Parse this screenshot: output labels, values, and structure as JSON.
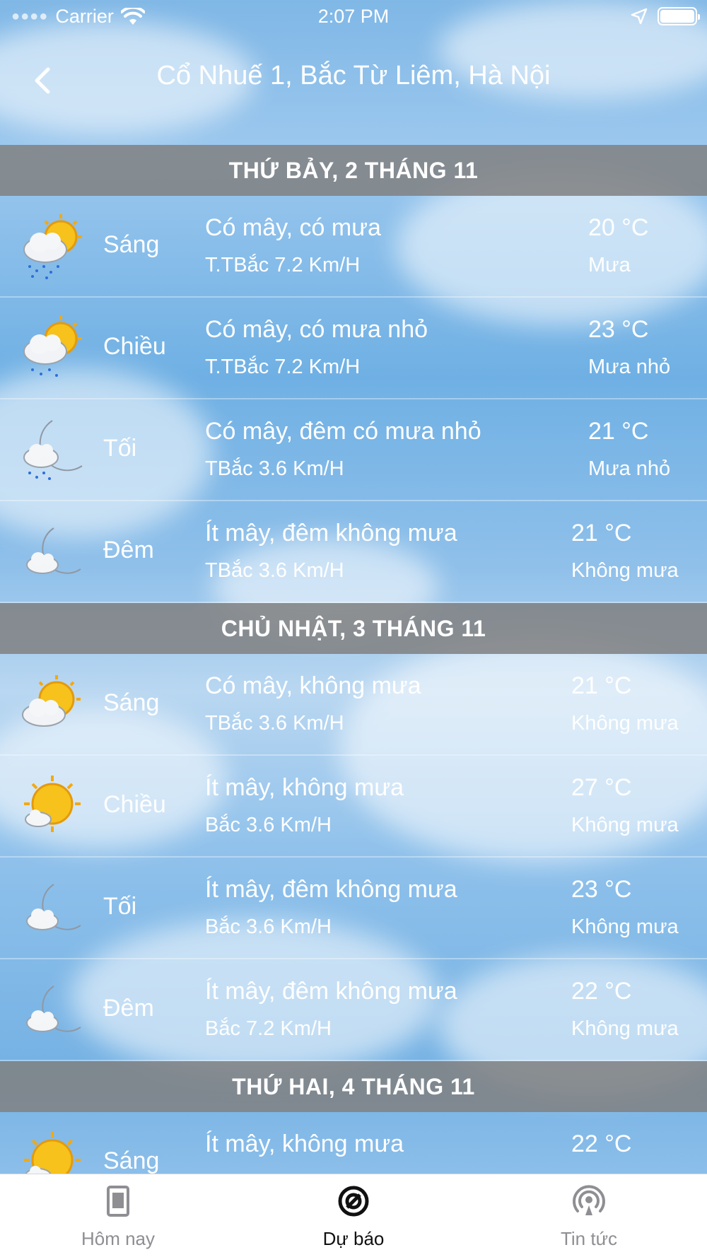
{
  "status_bar": {
    "carrier": "Carrier",
    "time": "2:07 PM"
  },
  "nav": {
    "title": "Cổ Nhuế 1, Bắc Từ Liêm, Hà Nội"
  },
  "days": [
    {
      "header": "THỨ BẢY, 2 THÁNG 11",
      "rows": [
        {
          "icon": "cloud-sun-rain-icon",
          "period": "Sáng",
          "desc": "Có mây, có mưa",
          "wind": "T.TBắc 7.2 Km/H",
          "temp": "20 °C",
          "rain": "Mưa"
        },
        {
          "icon": "cloud-sun-rain-icon",
          "period": "Chiều",
          "desc": "Có mây, có mưa nhỏ",
          "wind": "T.TBắc 7.2 Km/H",
          "temp": "23 °C",
          "rain": "Mưa nhỏ"
        },
        {
          "icon": "moon-cloud-rain-icon",
          "period": "Tối",
          "desc": "Có mây, đêm có mưa nhỏ",
          "wind": "TBắc 3.6 Km/H",
          "temp": "21 °C",
          "rain": "Mưa nhỏ"
        },
        {
          "icon": "moon-cloud-icon",
          "period": "Đêm",
          "desc": "Ít mây, đêm không mưa",
          "wind": "TBắc 3.6 Km/H",
          "temp": "21 °C",
          "rain": "Không mưa"
        }
      ]
    },
    {
      "header": "CHỦ NHẬT, 3 THÁNG 11",
      "rows": [
        {
          "icon": "cloud-sun-icon",
          "period": "Sáng",
          "desc": "Có mây, không mưa",
          "wind": "TBắc 3.6 Km/H",
          "temp": "21 °C",
          "rain": "Không mưa"
        },
        {
          "icon": "sun-small-cloud-icon",
          "period": "Chiều",
          "desc": "Ít mây, không mưa",
          "wind": "Bắc 3.6 Km/H",
          "temp": "27 °C",
          "rain": "Không mưa"
        },
        {
          "icon": "moon-cloud-icon",
          "period": "Tối",
          "desc": "Ít mây, đêm không mưa",
          "wind": "Bắc 3.6 Km/H",
          "temp": "23 °C",
          "rain": "Không mưa"
        },
        {
          "icon": "moon-cloud-icon",
          "period": "Đêm",
          "desc": "Ít mây, đêm không mưa",
          "wind": "Bắc 7.2 Km/H",
          "temp": "22 °C",
          "rain": "Không mưa"
        }
      ]
    },
    {
      "header": "THỨ HAI, 4 THÁNG 11",
      "rows": [
        {
          "icon": "sun-small-cloud-icon",
          "period": "Sáng",
          "desc": "Ít mây, không mưa",
          "wind": "",
          "temp": "22 °C",
          "rain": ""
        }
      ]
    }
  ],
  "tabs": [
    {
      "label": "Hôm nay",
      "icon": "document-icon",
      "active": false
    },
    {
      "label": "Dự báo",
      "icon": "forecast-icon",
      "active": true
    },
    {
      "label": "Tin tức",
      "icon": "broadcast-icon",
      "active": false
    }
  ]
}
